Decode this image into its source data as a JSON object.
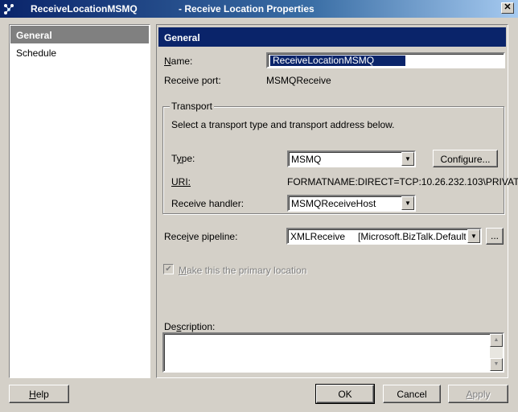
{
  "window": {
    "title_left": "ReceiveLocationMSMQ",
    "title_right": "- Receive Location Properties",
    "close_glyph": "✕"
  },
  "nav": {
    "items": [
      {
        "label": "General",
        "selected": true
      },
      {
        "label": "Schedule",
        "selected": false
      }
    ]
  },
  "general": {
    "header": "General",
    "name_label_u": "N",
    "name_label_rest": "ame:",
    "name_value": "ReceiveLocationMSMQ",
    "receive_port_label": "Receive port:",
    "receive_port_value": "MSMQReceive",
    "transport": {
      "legend": "Transport",
      "instructions": "Select a transport type and transport address below.",
      "type_label_pre": "T",
      "type_label_u": "y",
      "type_label_post": "pe:",
      "type_value": "MSMQ",
      "configure_label": "Configure...",
      "uri_label": "URI:",
      "uri_value": "FORMATNAME:DIRECT=TCP:10.26.232.103\\PRIVAT",
      "handler_label": "Receive handler:",
      "handler_value": "MSMQReceiveHost"
    },
    "pipeline": {
      "label_pre": "Rece",
      "label_u": "i",
      "label_post": "ve pipeline:",
      "value_name": "XMLReceive",
      "value_assembly": "[Microsoft.BizTalk.DefaultPip",
      "browse_label": "..."
    },
    "primary_location": {
      "label_u": "M",
      "label_rest": "ake this the primary location",
      "checked": true,
      "enabled": false
    },
    "description_label_pre": "De",
    "description_label_u": "s",
    "description_label_post": "cription:",
    "description_value": ""
  },
  "footer": {
    "help_u": "H",
    "help_rest": "elp",
    "ok": "OK",
    "cancel": "Cancel",
    "apply_u": "A",
    "apply_rest": "pply"
  },
  "colors": {
    "titlebar": "#0a246a",
    "selection": "#0a246a",
    "dialog_bg": "#d4d0c8",
    "nav_selected": "#808080"
  }
}
